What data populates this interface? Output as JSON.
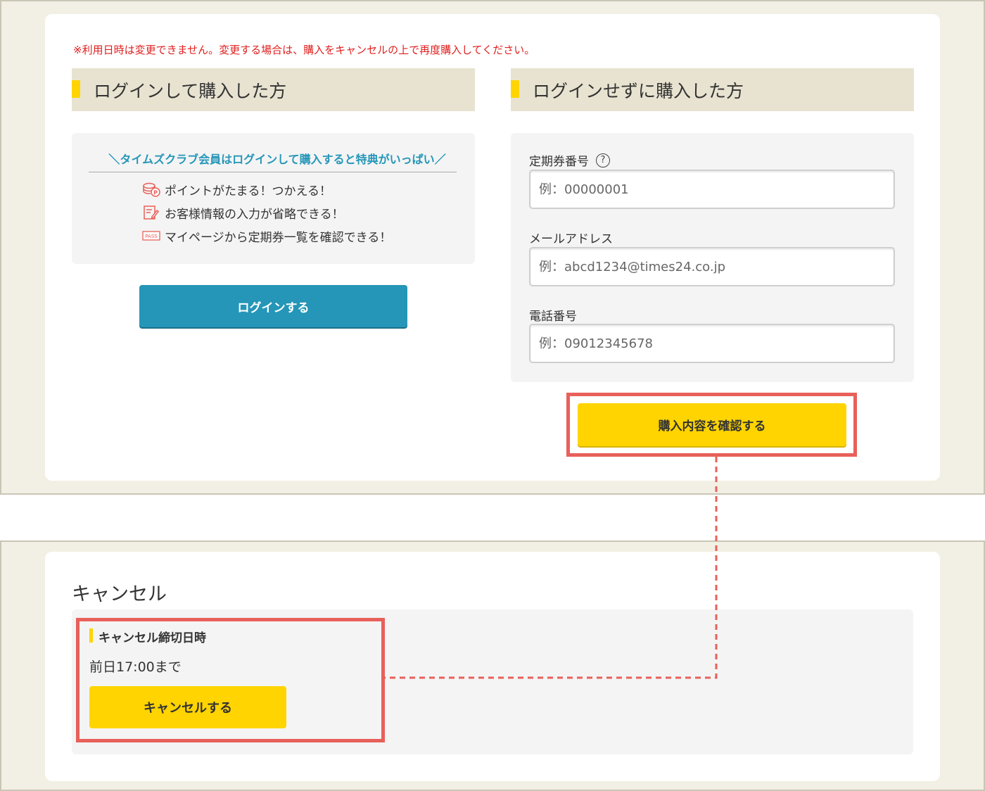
{
  "notice": "※利用日時は変更できません。変更する場合は、購入をキャンセルの上で再度購入してください。",
  "login_section": {
    "heading": "ログインして購入した方",
    "benefits_title": "＼タイムズクラブ会員はログインして購入すると特典がいっぱい／",
    "benefits": [
      {
        "icon": "coin-points-icon",
        "text": "ポイントがたまる！つかえる！"
      },
      {
        "icon": "edit-form-icon",
        "text": "お客様情報の入力が省略できる！"
      },
      {
        "icon": "pass-icon",
        "icon_text": "PASS",
        "text": "マイページから定期券一覧を確認できる！"
      }
    ],
    "login_button": "ログインする"
  },
  "guest_section": {
    "heading": "ログインせずに購入した方",
    "pass_number": {
      "label": "定期券番号",
      "help": "?",
      "placeholder": "例：00000001",
      "value": ""
    },
    "email": {
      "label": "メールアドレス",
      "placeholder": "例：abcd1234@times24.co.jp",
      "value": ""
    },
    "phone": {
      "label": "電話番号",
      "placeholder": "例：09012345678",
      "value": ""
    },
    "confirm_button": "購入内容を確認する"
  },
  "cancel_section": {
    "title": "キャンセル",
    "deadline_label": "キャンセル締切日時",
    "deadline_value": "前日17:00まで",
    "cancel_button": "キャンセルする"
  },
  "colors": {
    "accent_yellow": "#ffd400",
    "login_blue": "#2596b8",
    "highlight_red": "#e8605a",
    "notice_red": "#e02020",
    "heading_bg": "#e8e3d0",
    "page_bg": "#f2f0e4"
  }
}
